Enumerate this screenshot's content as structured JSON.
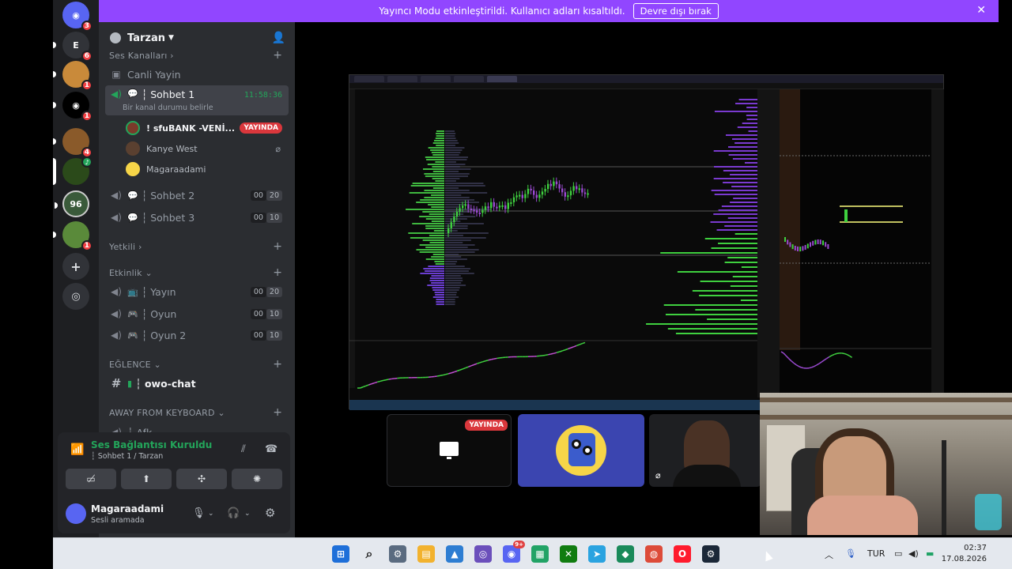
{
  "banner": {
    "message": "Yayıncı Modu etkinleştirildi. Kullanıcı adları kısaltıldı.",
    "button_label": "Devre dışı bırak",
    "color": "#9146ff"
  },
  "rail": {
    "servers": [
      {
        "name": "discord-home",
        "badge": "3"
      },
      {
        "name": "server-e",
        "badge": "6"
      },
      {
        "name": "server-avatar-1",
        "badge": "1"
      },
      {
        "name": "server-discord-2",
        "badge": "1"
      },
      {
        "name": "server-avatar-2",
        "badge": "4"
      },
      {
        "name": "server-tarzan",
        "badge": ""
      },
      {
        "name": "server-96",
        "badge": ""
      },
      {
        "name": "server-avatar-3",
        "badge": "1"
      }
    ]
  },
  "sidebar": {
    "server_name": "Tarzan",
    "category_voice": "Ses Kanalları",
    "channels": {
      "canli": "Canli Yayin",
      "sohbet1": "┆ Sohbet 1",
      "sohbet1_status": "Bir kanal durumu belirle",
      "sohbet1_timer": "11:58:36",
      "sohbet2": "┆ Sohbet 2",
      "sohbet3": "┆ Sohbet 3",
      "yayin": "┆ Yayın",
      "oyun": "┆ Oyun",
      "oyun2": "┆ Oyun 2",
      "owo": "┆ owo-chat",
      "afk": "┆ Afk"
    },
    "limits": {
      "sohbet2": [
        "00",
        "20"
      ],
      "sohbet3": [
        "00",
        "10"
      ],
      "yayin": [
        "00",
        "20"
      ],
      "oyun": [
        "00",
        "10"
      ],
      "oyun2": [
        "00",
        "10"
      ]
    },
    "users": [
      {
        "name": "! ꜱfuBANK -VENİ...",
        "live": "YAYINDA"
      },
      {
        "name": "Kanye West",
        "live": ""
      },
      {
        "name": "Magaraadami",
        "live": ""
      }
    ],
    "categories": {
      "yetkili": "Yetkili",
      "etkinlik": "Etkinlik",
      "eglence": "EĞLENCE",
      "afk": "AWAY FROM KEYBOARD"
    }
  },
  "voice_panel": {
    "title": "Ses Bağlantısı Kuruldu",
    "subtitle": "┆ Sohbet 1 / Tarzan",
    "accent": "#23a55a"
  },
  "user_panel": {
    "username": "Magaraadami",
    "status": "Sesli aramada"
  },
  "stage": {
    "tile_live_label": "YAYINDA"
  },
  "taskbar": {
    "lang": "TUR",
    "time": "02:37",
    "date": "17.08.2026",
    "discord_badge": "9+"
  }
}
